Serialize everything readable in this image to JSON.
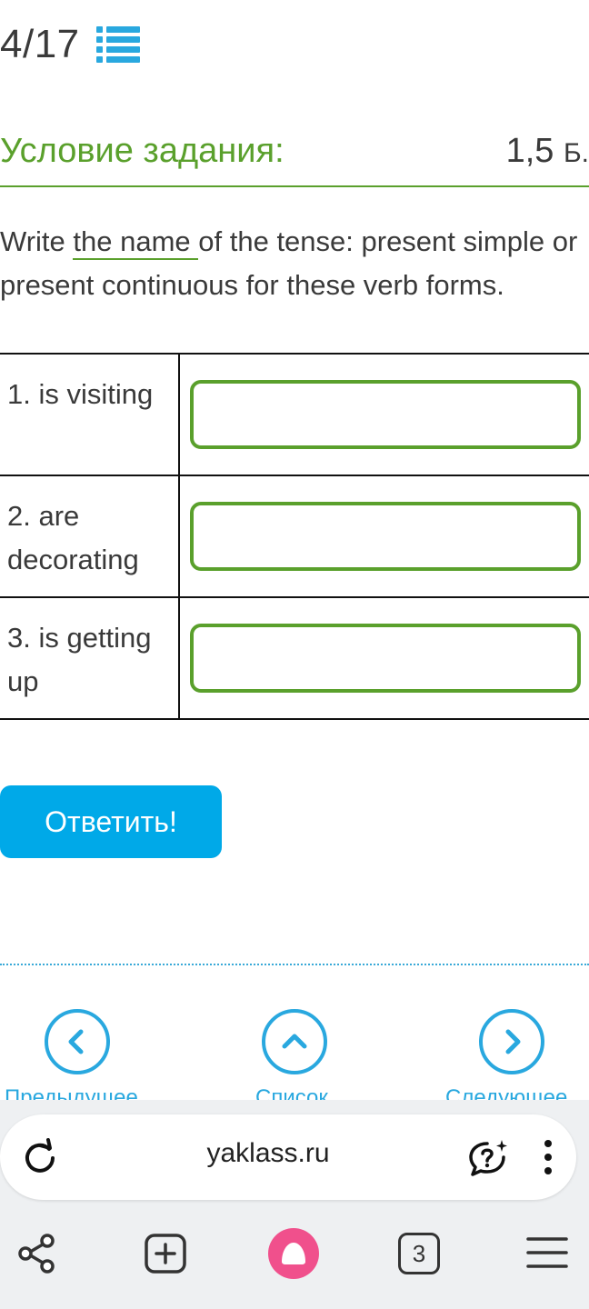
{
  "header": {
    "counter": "4/17",
    "list_icon": "list-icon"
  },
  "condition": {
    "title": "Условие задания:",
    "score": "1,5",
    "score_unit": "Б."
  },
  "task": {
    "text_before": "Write ",
    "text_underlined": "the name ",
    "text_after": "of the tense: present simple or present continuous for these verb forms."
  },
  "questions": [
    {
      "label": "1. is visiting",
      "value": ""
    },
    {
      "label": "2. are decorating",
      "value": ""
    },
    {
      "label": "3. is getting up",
      "value": ""
    }
  ],
  "submit": {
    "label": "Ответить!"
  },
  "navigation": {
    "prev_label": "Предыдущее",
    "list_label": "Список",
    "next_label": "Следующее"
  },
  "browser": {
    "url": "yaklass.ru",
    "tab_count": "3",
    "icons": [
      "reload-icon",
      "chat-question-icon",
      "more-vertical-icon",
      "share-icon",
      "new-tab-icon",
      "alice-icon",
      "tabs-icon",
      "menu-icon"
    ]
  },
  "colors": {
    "accent_green": "#5aa02c",
    "accent_blue": "#00a9e8",
    "nav_blue": "#29a8df",
    "alice_pink": "#f0508c"
  }
}
